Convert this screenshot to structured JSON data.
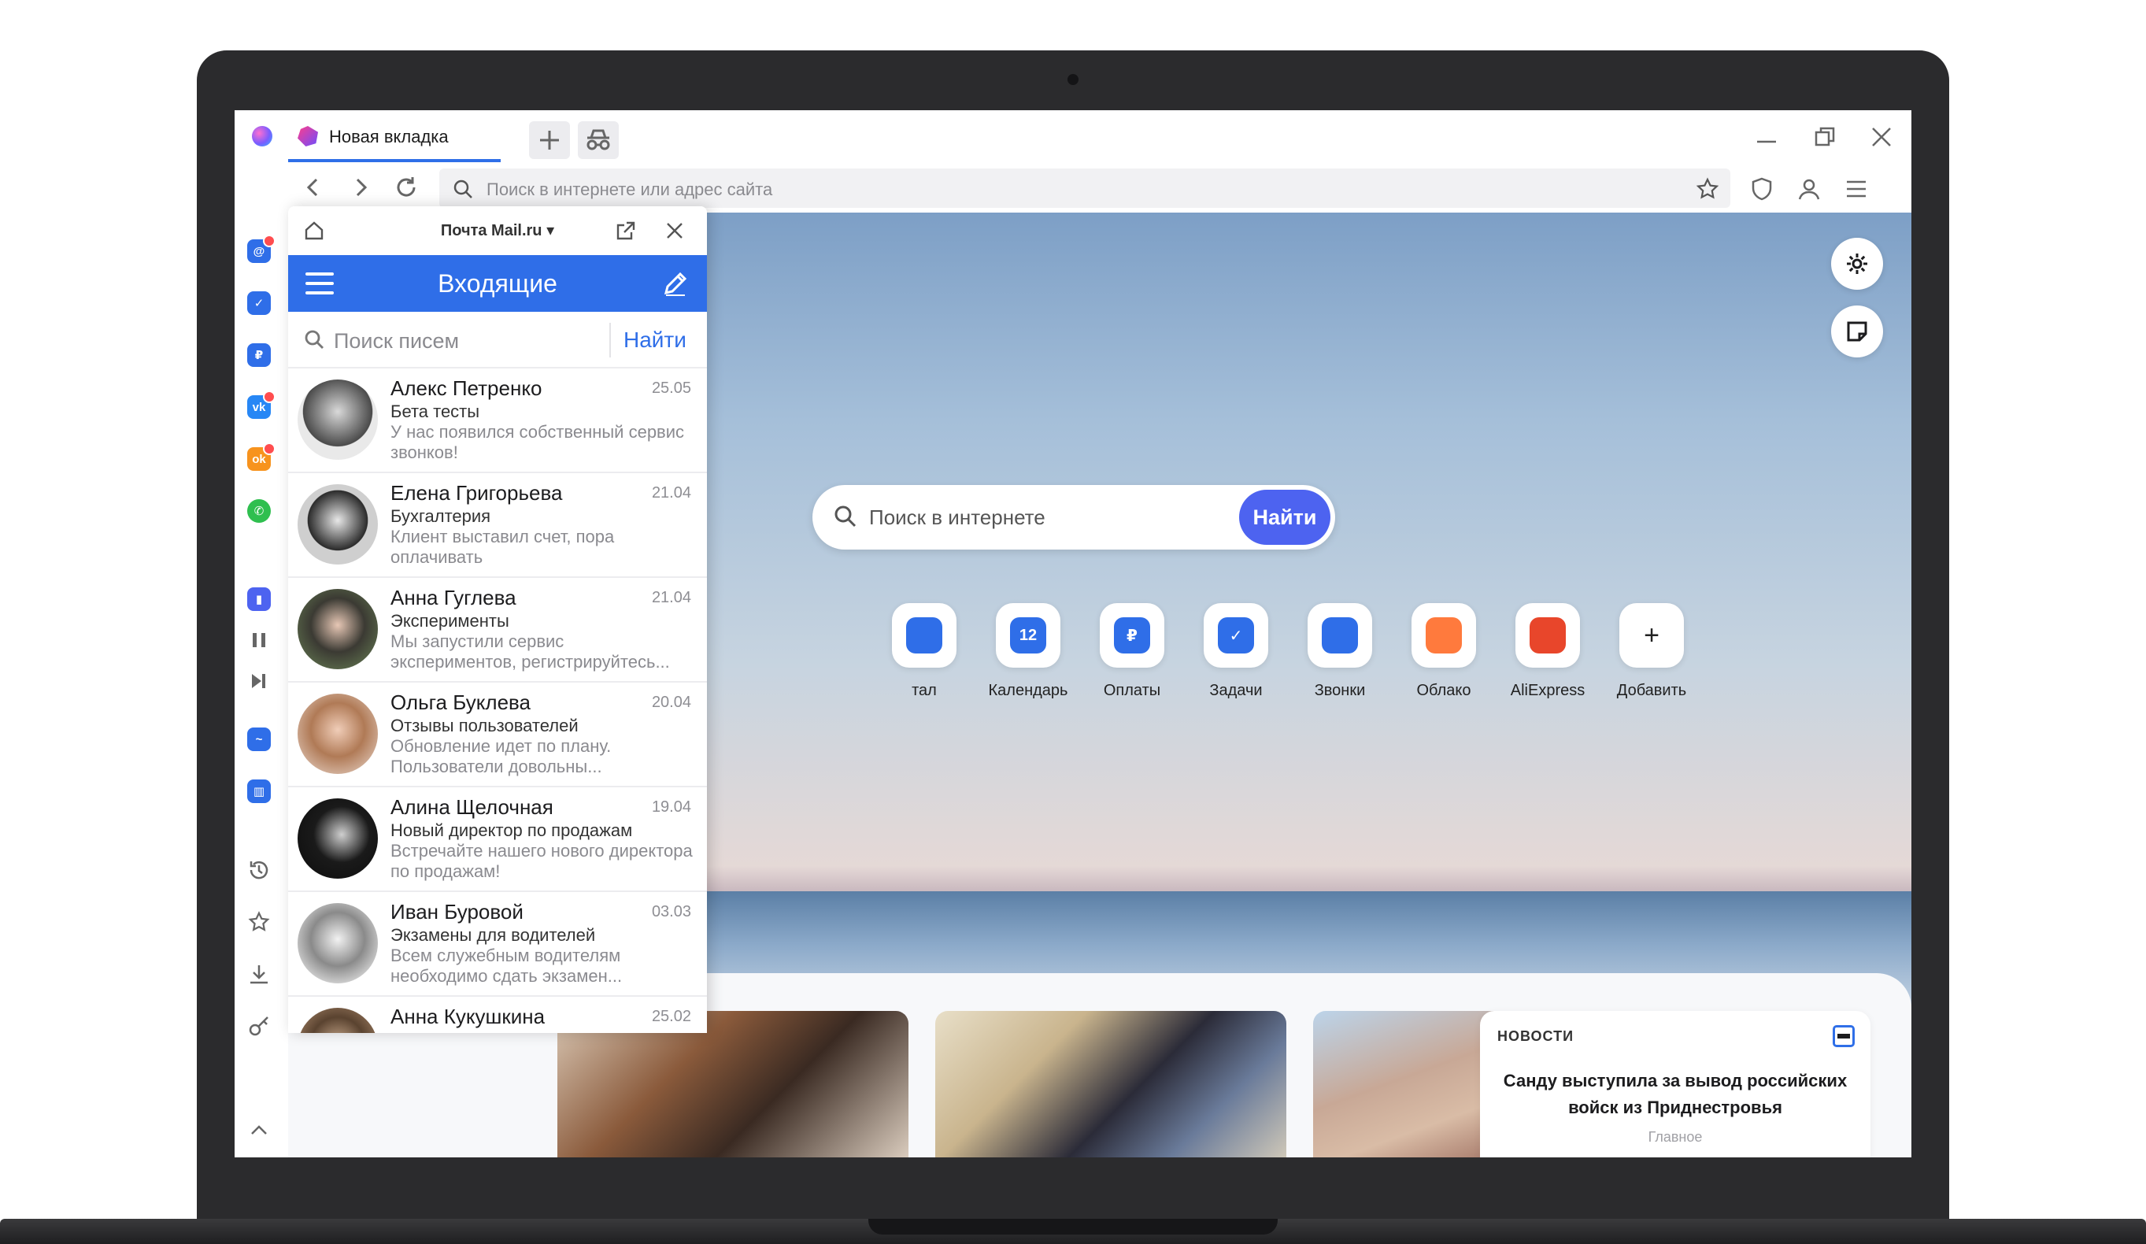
{
  "browser": {
    "tab_title": "Новая вкладка",
    "address_placeholder": "Поиск в интернете или адрес сайта"
  },
  "mail": {
    "service_name": "Почта Mail.ru",
    "folder_title": "Входящие",
    "search_placeholder": "Поиск писем",
    "search_button": "Найти",
    "messages": [
      {
        "name": "Алекс Петренко",
        "date": "25.05",
        "subject": "Бета тесты",
        "preview": "У нас появился собственный сервис звонков!"
      },
      {
        "name": "Елена Григорьева",
        "date": "21.04",
        "subject": "Бухгалтерия",
        "preview": "Клиент выставил счет, пора оплачивать"
      },
      {
        "name": "Анна Гуглева",
        "date": "21.04",
        "subject": "Эксперименты",
        "preview": "Мы запустили сервис экспериментов, регистрируйтесь..."
      },
      {
        "name": "Ольга Буклева",
        "date": "20.04",
        "subject": "Отзывы пользователей",
        "preview": "Обновление идет по плану. Пользователи довольны..."
      },
      {
        "name": "Алина Щелочная",
        "date": "19.04",
        "subject": "Новый директор по продажам",
        "preview": "Встречайте нашего нового директора по продажам!"
      },
      {
        "name": "Иван Буровой",
        "date": "03.03",
        "subject": "Экзамены для водителей",
        "preview": "Всем служебным водителям необходимо сдать экзамен..."
      },
      {
        "name": "Анна Кукушкина",
        "date": "25.02",
        "subject": "",
        "preview": ""
      }
    ]
  },
  "newtab": {
    "search_placeholder": "Поиск в интернете",
    "search_button": "Найти",
    "tiles": [
      {
        "label": "тал",
        "icon": "portal-icon",
        "color": "#2f6ee8"
      },
      {
        "label": "Календарь",
        "icon": "calendar-icon",
        "color": "#2f6ee8",
        "text": "12"
      },
      {
        "label": "Оплаты",
        "icon": "payments-icon",
        "color": "#2f6ee8",
        "text": "₽"
      },
      {
        "label": "Задачи",
        "icon": "tasks-icon",
        "color": "#2f6ee8",
        "text": "✓"
      },
      {
        "label": "Звонки",
        "icon": "calls-icon",
        "color": "#2f6ee8"
      },
      {
        "label": "Облако",
        "icon": "cloud-icon",
        "color": "#ff7a3d"
      },
      {
        "label": "AliExpress",
        "icon": "aliexpress-icon",
        "color": "#e8462b"
      },
      {
        "label": "Добавить",
        "icon": "plus-icon",
        "color": "#ffffff",
        "text": "+"
      }
    ],
    "news": {
      "heading": "НОВОСТИ",
      "title": "Санду выступила за вывод российских войск из Приднестровья",
      "source": "Главное"
    }
  }
}
